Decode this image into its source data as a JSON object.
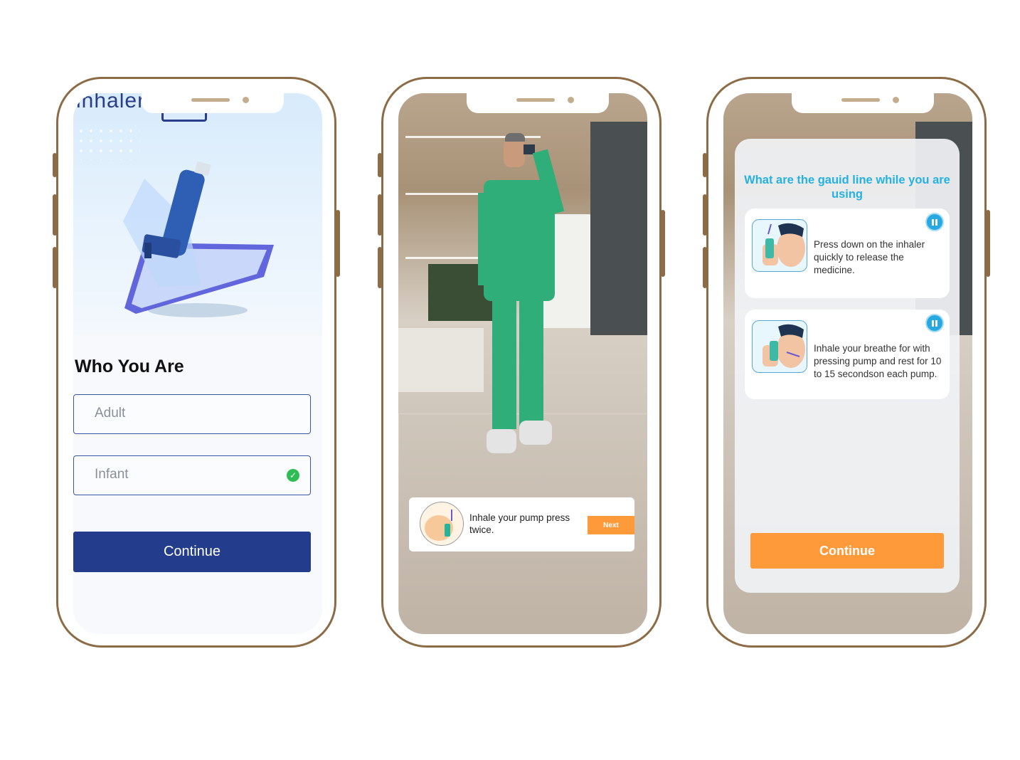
{
  "screen1": {
    "logo_text": "inhaler",
    "heading": "Who You Are",
    "options": [
      {
        "label": "Adult",
        "selected": false
      },
      {
        "label": "Infant",
        "selected": true
      }
    ],
    "continue_label": "Continue",
    "accent_color": "#233d8c"
  },
  "screen2": {
    "tip_text": "Inhale your pump press twice.",
    "next_label": "Next",
    "accent_color": "#ff9a3a"
  },
  "screen3": {
    "title": "What are the gauid line while you are using",
    "cards": [
      {
        "text": "Press down on the inhaler quickly to release the medicine.",
        "icon": "pause-icon"
      },
      {
        "text": "Inhale your breathe for with pressing pump and rest for 10 to 15 secondson each pump.",
        "icon": "pause-icon"
      }
    ],
    "continue_label": "Continue",
    "title_color": "#25b1e3",
    "button_color": "#ff9a3a"
  }
}
